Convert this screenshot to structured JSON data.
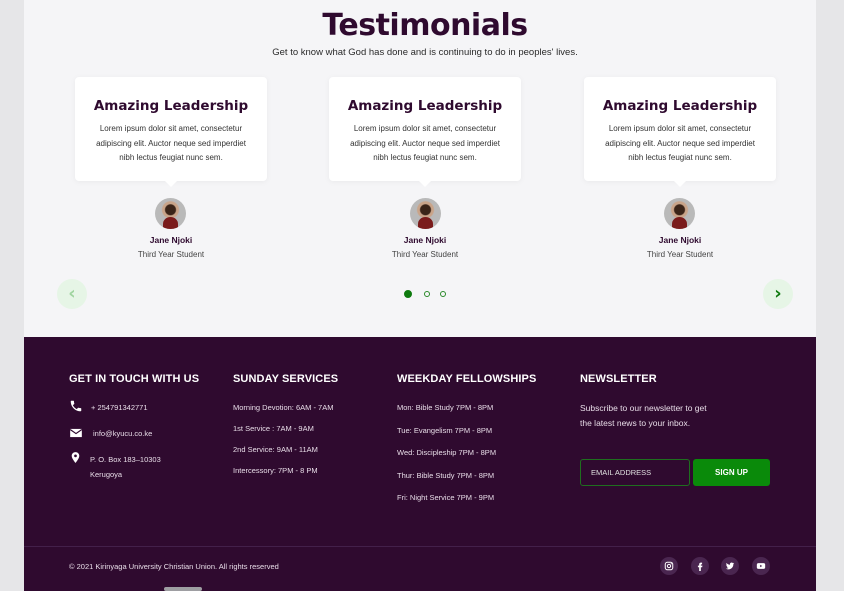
{
  "testimonials": {
    "title": "Testimonials",
    "subtitle": "Get to know what God has done and is continuing to do in peoples' lives.",
    "cards": [
      {
        "title": "Amazing Leadership",
        "body": "Lorem ipsum dolor sit amet, consectetur adipiscing elit. Auctor neque sed imperdiet nibh lectus feugiat nunc sem.",
        "name": "Jane Njoki",
        "role": "Third Year Student"
      },
      {
        "title": "Amazing Leadership",
        "body": "Lorem ipsum dolor sit amet, consectetur adipiscing elit. Auctor neque sed imperdiet nibh lectus feugiat nunc sem.",
        "name": "Jane Njoki",
        "role": "Third Year Student"
      },
      {
        "title": "Amazing Leadership",
        "body": "Lorem ipsum dolor sit amet, consectetur adipiscing elit. Auctor neque sed imperdiet nibh lectus feugiat nunc sem.",
        "name": "Jane Njoki",
        "role": "Third Year Student"
      }
    ],
    "prev_arrow": "‹",
    "next_arrow": "›",
    "active_slide": 1,
    "slide_count": 3
  },
  "footer": {
    "contact": {
      "title": "GET IN TOUCH WITH US",
      "phone": "+ 254791342771",
      "email": "info@kyucu.co.ke",
      "address_line1": "P. O. Box 183–10303",
      "address_line2": "Kerugoya",
      "icons": [
        "phone-icon",
        "mail-icon",
        "map-pin-icon"
      ]
    },
    "sunday": {
      "title": "SUNDAY SERVICES",
      "items": [
        "Morning Devotion: 6AM - 7AM",
        "1st Service : 7AM - 9AM",
        "2nd Service: 9AM - 11AM",
        "Intercessory: 7PM - 8 PM"
      ]
    },
    "weekday": {
      "title": "WEEKDAY FELLOWSHIPS",
      "items": [
        "Mon: Bible Study 7PM - 8PM",
        "Tue: Evangelism 7PM - 8PM",
        "Wed: Discipleship 7PM - 8PM",
        "Thur: Bible Study 7PM - 8PM",
        "Fri: Night Service 7PM - 9PM"
      ]
    },
    "newsletter": {
      "title": "NEWSLETTER",
      "text": "Subscribe to our newsletter to get the latest news to your inbox.",
      "email_placeholder": "EMAIL ADDRESS",
      "email_value": "",
      "signup_label": "SIGN UP"
    },
    "copyright": "© 2021 Kirinyaga University Christian Union. All rights reserved",
    "socials": [
      "instagram-icon",
      "facebook-icon",
      "twitter-icon",
      "youtube-icon"
    ]
  },
  "colors": {
    "brand_dark": "#2f0a2f",
    "accent_green": "#0a8a0a",
    "section_bg": "#f5f5f7"
  }
}
